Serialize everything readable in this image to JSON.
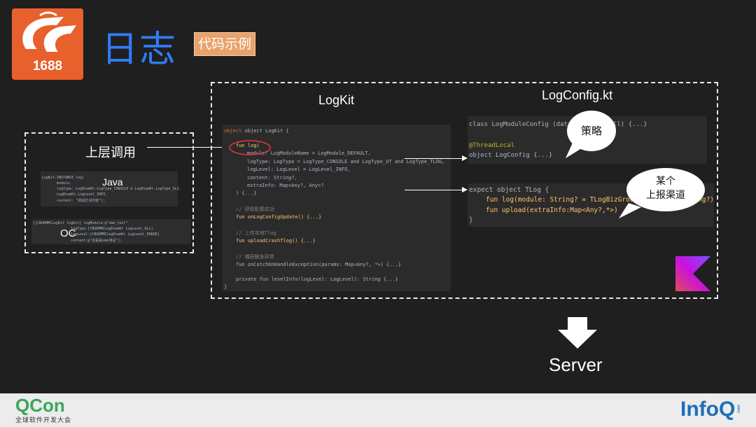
{
  "header": {
    "logo_text": "1688",
    "title": "日志",
    "tag": "代码示例"
  },
  "left": {
    "caller_label": "上层调用",
    "java_label": "Java",
    "oc_label": "OC",
    "java_lines": [
      "LogKit.INSTANCE.log(",
      "       module,",
      "       logType: LogEnumKt.LogType_CONSOLE & LogEnumKt.LogType_SLS,",
      "       LogEnumKt.LogLevel_INFO,",
      "       content: \"测试打点内容\");"
    ],
    "oc_lines": [
      "[[CBUKMMCLogKit logKit] logModule:@\"xmm_test\"",
      "                  logType:[CBUKMMCLogEnumKt LogLevel_ALL]",
      "                  logLevel:[CBUKMMCLogEnumKt LogLevel_ERROR]",
      "                  content:@\"这是是xmm测试\"];"
    ]
  },
  "logkit": {
    "label": "LogKit",
    "lines": {
      "l1": "object LogKit {",
      "l2": "fun log(",
      "l3": "module: LogModuleName = LogModule_DEFAULT,",
      "l4": "logType: LogType = LogType_CONSOLE and LogType_UT and LogType_TLOG,",
      "l5": "logLevel: LogLevel = LogLevel_INFO,",
      "l6": "content: String?,",
      "l7": "extraInfo: Map<Any?, Any>?",
      "l8": ") {...}",
      "c1": "// 获取配置成功",
      "f1": "fun onLogConfigUpdate() {...}",
      "c2": "// 上传本地Tlog",
      "f2": "fun uploadCrashTlog() {...}",
      "c3": "// 捕获触发异常",
      "f3": "fun onCatchUnHandleException(params: Map<Any?, *>) {...}",
      "f4": "private fun levelInfo(logLevel: LogLevel): String {...}",
      "end": "}"
    }
  },
  "logconfig": {
    "label": "LogConfig.kt",
    "lines": {
      "a1": "class LogModuleConfig (data: Any? = null) {...}",
      "a2": "@ThreadLocal",
      "a3": "object LogConfig {...}",
      "b1": "expect object TLog {",
      "b2": "fun log(module: String? = TLogBizGroup, content: String?)",
      "b3": "fun upload(extraInfo:Map<Any?,*>)",
      "b4": "}"
    },
    "bubble_strategy": "策略",
    "bubble_channel_1": "某个",
    "bubble_channel_2": "上报渠道"
  },
  "server_label": "Server",
  "footer": {
    "qcon": "QCon",
    "qcon_sub": "全球软件开发大会",
    "infoq": "InfoQ",
    "infoq_sup": "极客邦"
  },
  "colors": {
    "title_blue": "#2f7df6",
    "logo_orange": "#e8602c",
    "tag_orange": "#e9a26a",
    "highlight_red": "#e53935",
    "qcon_green": "#3aa757",
    "infoq_blue": "#1d6fb8"
  }
}
